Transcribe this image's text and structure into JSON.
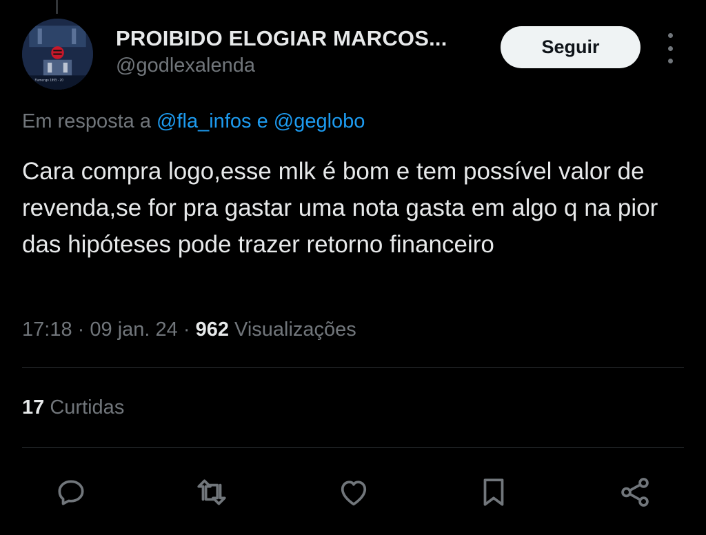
{
  "author": {
    "display_name": "PROIBIDO ELOGIAR MARCOS...",
    "handle": "@godlexalenda",
    "avatar_caption": "Flamengo 1895 - 20"
  },
  "follow_button": {
    "label": "Seguir"
  },
  "more_icon": "more-vertical-icon",
  "reply_context": {
    "prefix": "Em resposta a",
    "mention_1": "@fla_infos",
    "separator": "e",
    "mention_2": "@geglobo"
  },
  "tweet": {
    "text": "Cara compra logo,esse mlk é bom e tem possível valor de revenda,se for pra gastar uma nota gasta em algo q na pior das hipóteses pode trazer retorno financeiro"
  },
  "meta": {
    "time": "17:18",
    "dot_1": "·",
    "date": "09 jan. 24",
    "dot_2": "·",
    "views_count": "962",
    "views_label": "Visualizações"
  },
  "engagement": {
    "likes_count": "17",
    "likes_label": "Curtidas"
  },
  "actions": [
    {
      "icon": "reply-icon"
    },
    {
      "icon": "retweet-icon"
    },
    {
      "icon": "like-icon"
    },
    {
      "icon": "bookmark-icon"
    },
    {
      "icon": "share-icon"
    }
  ],
  "colors": {
    "background": "#000000",
    "primary_text": "#e7e9ea",
    "secondary_text": "#71767b",
    "link": "#1d9bf0",
    "follow_button_bg": "#eff3f4",
    "divider": "#2f3336"
  }
}
